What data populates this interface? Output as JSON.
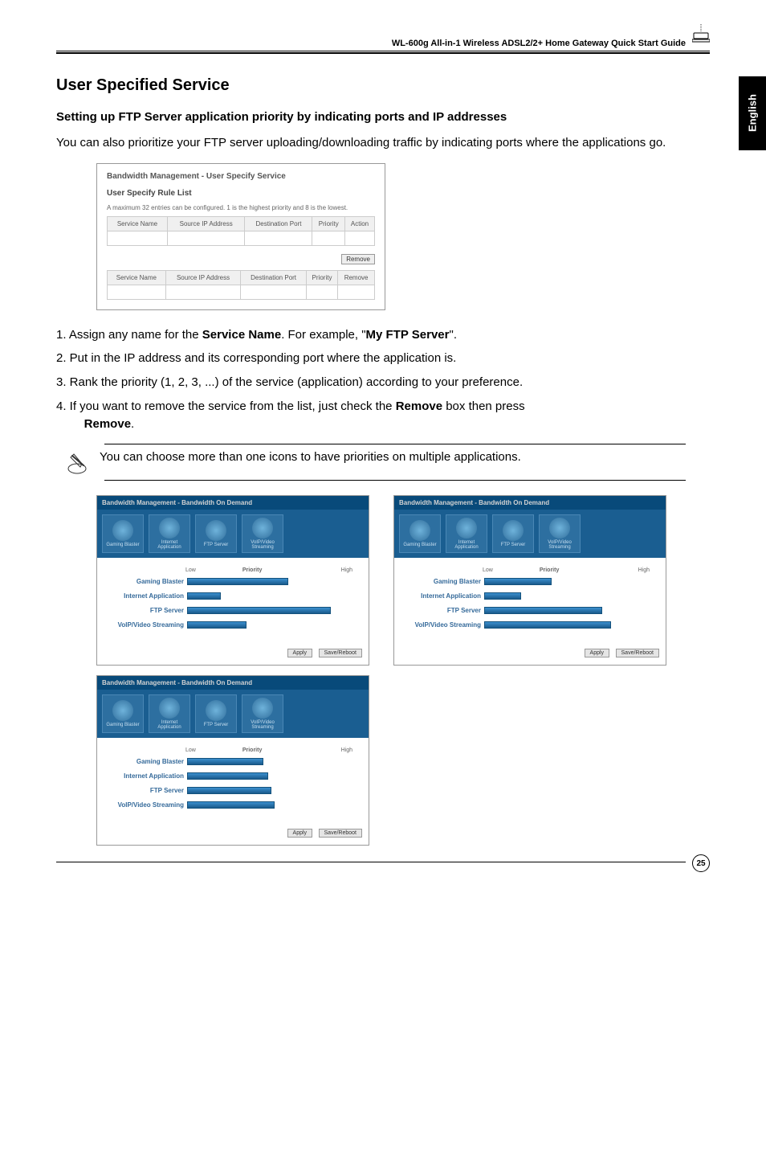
{
  "header": {
    "title": "WL-600g All-in-1 Wireless ADSL2/2+ Home Gateway Quick Start Guide"
  },
  "sideTab": "English",
  "section": {
    "title": "User Specified Service",
    "subtitle": "Setting up FTP Server application priority by indicating ports and IP addresses",
    "intro": "You can also prioritize your FTP server uploading/downloading traffic by indicating ports where the applications go."
  },
  "panel": {
    "title": "Bandwidth Management - User Specify Service",
    "sub": "User Specify Rule List",
    "desc": "A maximum 32 entries can be configured. 1 is the highest priority and 8 is the lowest.",
    "th1": "Service Name",
    "th2": "Source IP Address",
    "th3": "Destination Port",
    "th4": "Priority",
    "th5": "Action",
    "btnRemove": "Remove",
    "th1b": "Service Name",
    "th2b": "Source IP Address",
    "th3b": "Destination Port",
    "th4b": "Priority",
    "th5b": "Remove"
  },
  "steps": {
    "s1a": "1. Assign any name for the ",
    "s1b": "Service Name",
    "s1c": ". For example, \"",
    "s1d": "My FTP Server",
    "s1e": "\".",
    "s2": "2. Put in the IP address and its corresponding port where the application is.",
    "s3": "3. Rank the priority (1, 2, 3, ...) of the service (application) according to your preference.",
    "s4a": "4. If you want to remove the service from the list, just check the ",
    "s4b": "Remove",
    "s4c": " box then press ",
    "s4d": "Remove",
    "s4e": "."
  },
  "note": "You can choose more than one icons to have priorities on multiple applications.",
  "bw": {
    "header": "Bandwidth Management - Bandwidth On Demand",
    "icon1": "Gaming Blaster",
    "icon2": "Internet Application",
    "icon3": "FTP Server",
    "icon4": "VoIP/Video Streaming",
    "axisLow": "Low",
    "axisPriority": "Priority",
    "axisHigh": "High",
    "row1": "Gaming Blaster",
    "row2": "Internet Application",
    "row3": "FTP Server",
    "row4": "VoIP/Video Streaming",
    "btnApply": "Apply",
    "btnSave": "Save/Reboot"
  },
  "pageNumber": "25",
  "chart_data": [
    {
      "type": "bar",
      "title": "Bandwidth Management - Bandwidth On Demand (top-left)",
      "xlabel": "Priority",
      "categories": [
        "Gaming Blaster",
        "Internet Application",
        "FTP Server",
        "VoIP/Video Streaming"
      ],
      "values": [
        60,
        20,
        85,
        35
      ],
      "xlim": [
        0,
        100
      ],
      "axis_endpoints": [
        "Low",
        "High"
      ]
    },
    {
      "type": "bar",
      "title": "Bandwidth Management - Bandwidth On Demand (right)",
      "xlabel": "Priority",
      "categories": [
        "Gaming Blaster",
        "Internet Application",
        "FTP Server",
        "VoIP/Video Streaming"
      ],
      "values": [
        40,
        22,
        70,
        75
      ],
      "xlim": [
        0,
        100
      ],
      "axis_endpoints": [
        "Low",
        "High"
      ]
    },
    {
      "type": "bar",
      "title": "Bandwidth Management - Bandwidth On Demand (bottom-left)",
      "xlabel": "Priority",
      "categories": [
        "Gaming Blaster",
        "Internet Application",
        "FTP Server",
        "VoIP/Video Streaming"
      ],
      "values": [
        45,
        48,
        50,
        52
      ],
      "xlim": [
        0,
        100
      ],
      "axis_endpoints": [
        "Low",
        "High"
      ]
    }
  ]
}
